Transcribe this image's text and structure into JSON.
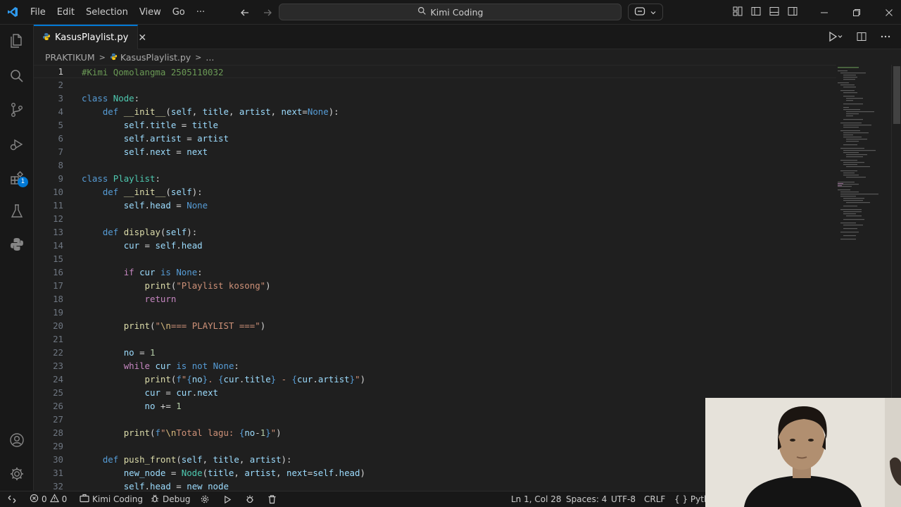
{
  "menu": [
    "File",
    "Edit",
    "Selection",
    "View",
    "Go",
    "···"
  ],
  "command_center": "Kimi Coding",
  "tab": {
    "label": "KasusPlaylist.py",
    "close": "✕"
  },
  "breadcrumb": {
    "folder": "PRAKTIKUM",
    "file": "KasusPlaylist.py",
    "more": "..."
  },
  "badge_count": "1",
  "line_numbers": [
    "1",
    "2",
    "3",
    "4",
    "5",
    "6",
    "7",
    "8",
    "9",
    "10",
    "11",
    "12",
    "13",
    "14",
    "15",
    "16",
    "17",
    "18",
    "19",
    "20",
    "21",
    "22",
    "23",
    "24",
    "25",
    "26",
    "27",
    "28",
    "29",
    "30",
    "31",
    "32"
  ],
  "status": {
    "errors": "0",
    "warnings": "0",
    "profile": "Kimi Coding",
    "debug": "Debug",
    "position": "Ln 1, Col 28",
    "spaces": "Spaces: 4",
    "encoding": "UTF-8",
    "eol": "CRLF",
    "language": "{ } Pyth"
  },
  "colors": {
    "accent": "#0078d4",
    "background": "#1f1f1f",
    "bar": "#181818"
  },
  "icons": [
    "vscode-logo-icon",
    "arrow-left-icon",
    "arrow-right-icon",
    "search-icon",
    "copilot-icon",
    "explorer-icon",
    "search-icon",
    "source-control-icon",
    "run-debug-icon",
    "extensions-icon",
    "testing-icon",
    "python-icon",
    "account-icon",
    "settings-icon",
    "run-icon",
    "split-editor-icon",
    "more-icon",
    "python-file-icon"
  ]
}
